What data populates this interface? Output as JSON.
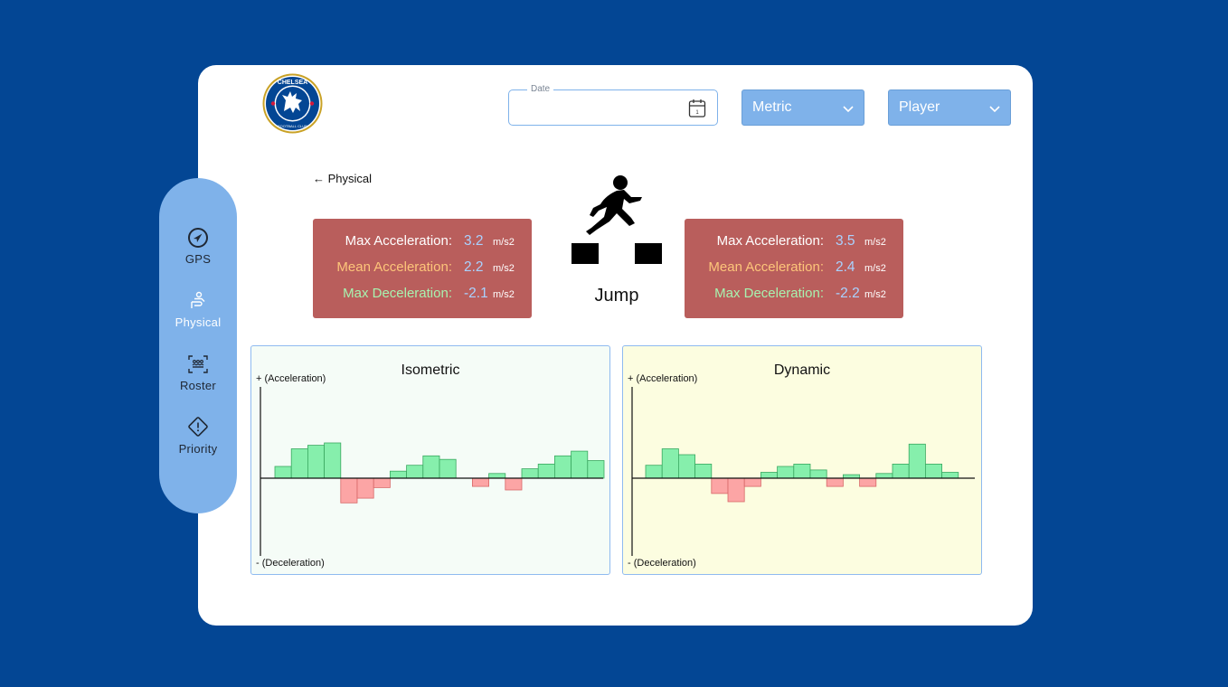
{
  "colors": {
    "background": "#034694",
    "sidebar": "#7fb2ea",
    "stat_box": "#b95e5c",
    "positive_bar": "#86efac",
    "negative_bar": "#fca5a5",
    "label_white": "#ffffff",
    "label_orange": "#fdc57a",
    "label_green": "#a7f3b0",
    "value_blue": "#a9d2ff"
  },
  "header": {
    "logo_icon": "chelsea-fc-crest",
    "logo_text": {
      "top": "CHELSEA",
      "bottom": "FOOTBALL CLUB"
    },
    "date": {
      "label": "Date",
      "value": "",
      "icon": "calendar-icon",
      "icon_day": "1"
    },
    "metric_select": {
      "label": "Metric",
      "icon": "chevron-down-icon"
    },
    "player_select": {
      "label": "Player",
      "icon": "chevron-down-icon"
    }
  },
  "sidebar": {
    "items": [
      {
        "label": "GPS",
        "icon": "navigation-icon",
        "active": false
      },
      {
        "label": "Physical",
        "icon": "physical-icon",
        "active": true
      },
      {
        "label": "Roster",
        "icon": "roster-icon",
        "active": false
      },
      {
        "label": "Priority",
        "icon": "warning-icon",
        "active": false
      }
    ]
  },
  "main": {
    "back_link": "← Physical",
    "exercise": {
      "label": "Jump",
      "icon": "jumping-person-icon"
    },
    "stats_left": [
      {
        "label": "Max Acceleration:",
        "value": "3.2",
        "unit": "m/s2",
        "color": "#ffffff"
      },
      {
        "label": "Mean Acceleration:",
        "value": "2.2",
        "unit": "m/s2",
        "color": "#fdc57a"
      },
      {
        "label": "Max Deceleration:",
        "value": "-2.1",
        "unit": "m/s2",
        "color": "#a7f3b0"
      }
    ],
    "stats_right": [
      {
        "label": "Max Acceleration:",
        "value": "3.5",
        "unit": "m/s2",
        "color": "#ffffff"
      },
      {
        "label": "Mean Acceleration:",
        "value": "2.4",
        "unit": "m/s2",
        "color": "#fdc57a"
      },
      {
        "label": "Max Deceleration:",
        "value": "-2.2",
        "unit": "m/s2",
        "color": "#a7f3b0"
      }
    ]
  },
  "chart_data": [
    {
      "type": "bar",
      "title": "Isometric",
      "ylabel_top": "+ (Acceleration)",
      "ylabel_bottom": "- (Deceleration)",
      "background": "#f5fcf7",
      "values": [
        0.5,
        1.25,
        1.4,
        1.5,
        -1.05,
        -0.85,
        -0.4,
        0.3,
        0.55,
        0.95,
        0.8,
        0,
        -0.35,
        0.2,
        -0.5,
        0.4,
        0.6,
        0.95,
        1.15,
        0.75
      ],
      "ylim": [
        -3.5,
        3.5
      ],
      "grid": false
    },
    {
      "type": "bar",
      "title": "Dynamic",
      "ylabel_top": "+ (Acceleration)",
      "ylabel_bottom": "- (Deceleration)",
      "background": "#fcfde0",
      "values": [
        0.55,
        1.25,
        1.0,
        0.6,
        -0.65,
        -1.0,
        -0.35,
        0.25,
        0.5,
        0.6,
        0.35,
        -0.35,
        0.15,
        -0.35,
        0.2,
        0.6,
        1.45,
        0.6,
        0.25
      ],
      "ylim": [
        -3.5,
        3.5
      ],
      "grid": false
    }
  ]
}
